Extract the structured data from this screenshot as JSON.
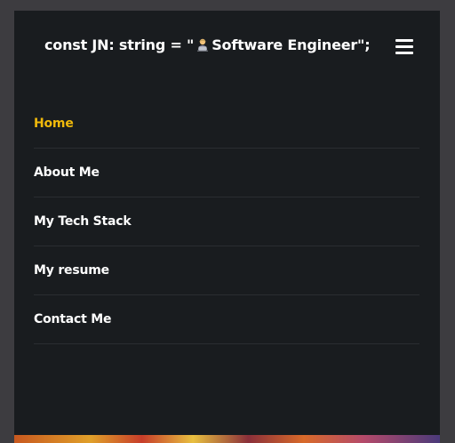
{
  "header": {
    "brand_prefix": "const JN: string = \"",
    "brand_title": "Software Engineer\";",
    "brand_icon": "technologist-emoji-icon",
    "menu_icon": "hamburger-menu-icon"
  },
  "nav": {
    "items": [
      {
        "label": "Home",
        "active": true
      },
      {
        "label": "About Me",
        "active": false
      },
      {
        "label": "My Tech Stack",
        "active": false
      },
      {
        "label": "My resume",
        "active": false
      },
      {
        "label": "Contact Me",
        "active": false
      }
    ]
  },
  "colors": {
    "page_bg": "#3d3c40",
    "panel_bg": "#191c1f",
    "active_link": "#f0b90b",
    "text": "#ffffff",
    "divider": "#2a2d31"
  }
}
